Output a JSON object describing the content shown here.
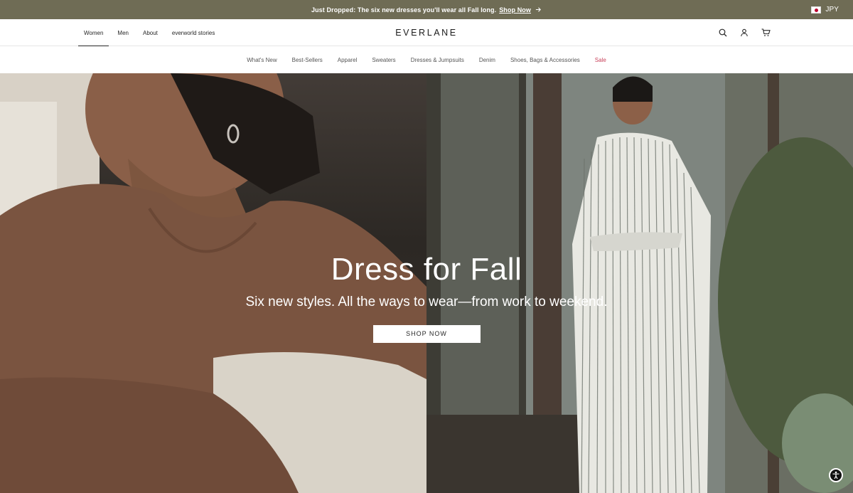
{
  "announcement": {
    "text": "Just Dropped: The six new dresses you'll wear all Fall long.",
    "link": "Shop Now",
    "currency": "JPY"
  },
  "primary_nav": {
    "items": [
      "Women",
      "Men",
      "About",
      "everworld stories"
    ],
    "active": "Women",
    "logo": "EVERLANE",
    "icons": [
      "search-icon",
      "account-icon",
      "cart-icon"
    ]
  },
  "category_nav": {
    "items": [
      "What's New",
      "Best-Sellers",
      "Apparel",
      "Sweaters",
      "Dresses & Jumpsuits",
      "Denim",
      "Shoes, Bags & Accessories",
      "Sale"
    ]
  },
  "hero": {
    "title": "Dress for Fall",
    "subtitle": "Six new styles. All the ways to wear—from work to weekend.",
    "cta": "SHOP NOW"
  },
  "colors": {
    "announcement_bg": "#6f6c55",
    "sale": "#c8415a",
    "text": "#262626"
  }
}
